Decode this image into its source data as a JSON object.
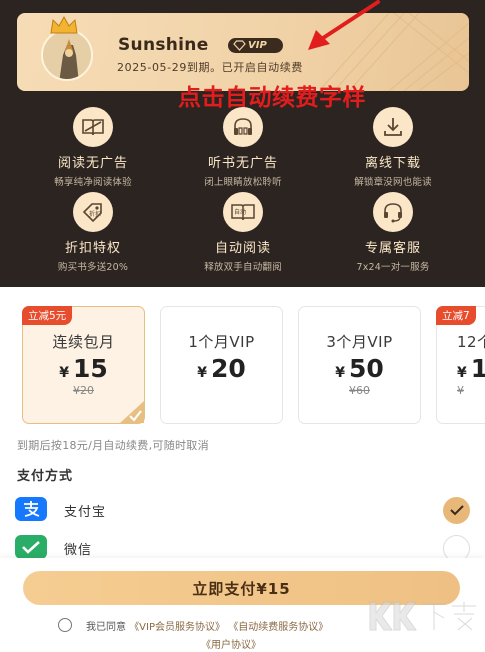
{
  "vip_card": {
    "username": "Sunshine",
    "vip_badge": "VIP",
    "expire_text": "2025-05-29到期。已开启自动续费"
  },
  "annotation": {
    "text": "点击自动续费字样",
    "color": "#e11d1d"
  },
  "benefits": [
    {
      "icon": "no-ads-book-icon",
      "title": "阅读无广告",
      "subtitle": "畅享纯净阅读体验"
    },
    {
      "icon": "headphones-book-icon",
      "title": "听书无广告",
      "subtitle": "闭上眼睛放松聆听"
    },
    {
      "icon": "download-icon",
      "title": "离线下载",
      "subtitle": "解锁章没网也能读"
    },
    {
      "icon": "discount-tag-icon",
      "title": "折扣特权",
      "subtitle": "购买书多送20%"
    },
    {
      "icon": "auto-read-book-icon",
      "title": "自动阅读",
      "subtitle": "释放双手自动翻阅"
    },
    {
      "icon": "headset-service-icon",
      "title": "专属客服",
      "subtitle": "7x24一对一服务"
    }
  ],
  "packages": [
    {
      "tag": "立减5元",
      "name": "连续包月",
      "currency": "¥",
      "price": "15",
      "original": "¥20",
      "selected": true
    },
    {
      "tag": "",
      "name": "1个月VIP",
      "currency": "¥",
      "price": "20",
      "original": "",
      "selected": false
    },
    {
      "tag": "",
      "name": "3个月VIP",
      "currency": "¥",
      "price": "50",
      "original": "¥60",
      "selected": false
    },
    {
      "tag": "立减7",
      "name": "12个",
      "currency": "¥",
      "price": "1",
      "original": "¥",
      "selected": false
    }
  ],
  "renew_note": "到期后按18元/月自动续费,可随时取消",
  "payment": {
    "title": "支付方式",
    "methods": [
      {
        "name": "支付宝",
        "icon": "alipay-icon",
        "color": "#1677ff",
        "selected": true
      },
      {
        "name": "微信",
        "icon": "wechat-icon",
        "color": "#2aae67",
        "selected": false
      }
    ]
  },
  "pay_button": "立即支付¥15",
  "agreement": {
    "prefix": "我已同意",
    "link1": "《VIP会员服务协议》",
    "link2": "《自动续费服务协议》",
    "link3": "《用户协议》"
  },
  "watermark": "KK下载",
  "colors": {
    "header_bg": "#2b2421",
    "gold": "#e8b878",
    "accent_red": "#e74c2d"
  }
}
